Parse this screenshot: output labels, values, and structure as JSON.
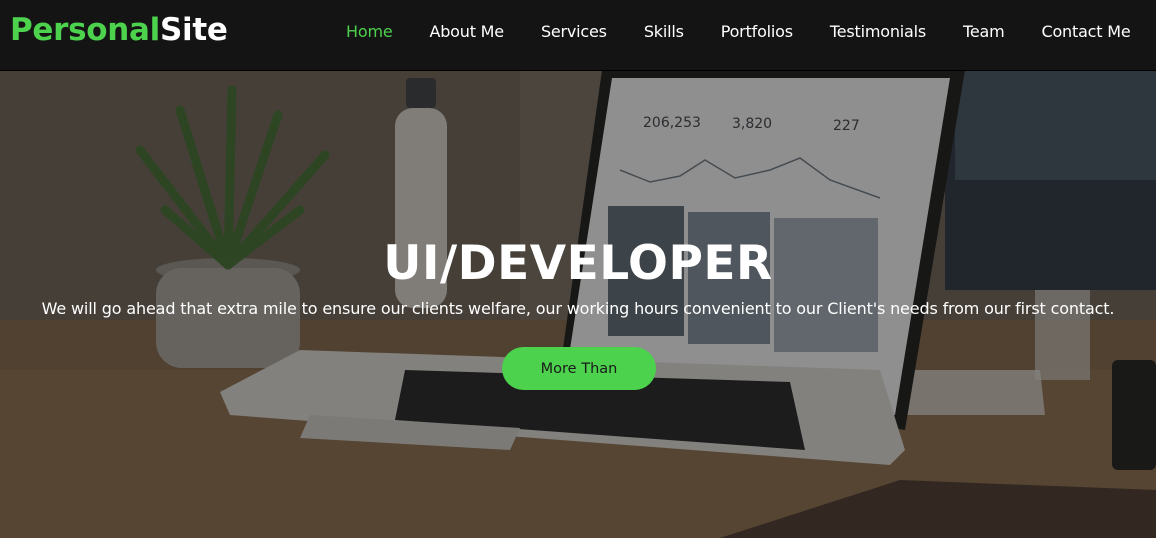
{
  "brand": {
    "part1": "Personal",
    "part2": "Site"
  },
  "nav": {
    "items": [
      {
        "label": "Home",
        "active": true
      },
      {
        "label": "About Me"
      },
      {
        "label": "Services"
      },
      {
        "label": "Skills"
      },
      {
        "label": "Portfolios"
      },
      {
        "label": "Testimonials"
      },
      {
        "label": "Team"
      },
      {
        "label": "Contact Me"
      }
    ]
  },
  "hero": {
    "title": "UI/DEVELOPER",
    "text": "We will go ahead that extra mile to ensure our clients welfare, our working hours convenient to our Client's needs from our first contact.",
    "button_label": "More Than",
    "background_image": {
      "stat_values": [
        "206,253",
        "3,820",
        "227"
      ]
    }
  },
  "colors": {
    "accent": "#4cd24c",
    "navbar_bg": "#141414",
    "text_light": "#ffffff"
  }
}
